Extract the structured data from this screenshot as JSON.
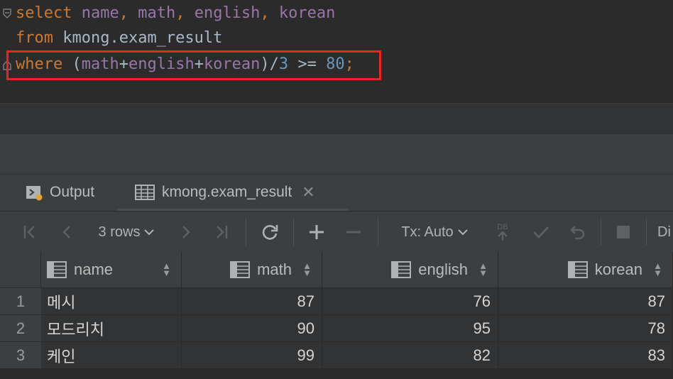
{
  "editor": {
    "line1": {
      "kw": "select",
      "cols": [
        "name",
        "math",
        "english",
        "korean"
      ]
    },
    "line2": {
      "kw": "from",
      "table": "kmong.exam_result"
    },
    "line3": {
      "kw": "where",
      "open": "(",
      "c1": "math",
      "plus1": "+",
      "c2": "english",
      "plus2": "+",
      "c3": "korean",
      "close": ")/",
      "n1": "3",
      "op": " >= ",
      "n2": "80",
      "end": ";"
    }
  },
  "tabs": [
    {
      "label": "Output",
      "icon": "console-icon"
    },
    {
      "label": "kmong.exam_result",
      "icon": "table-icon",
      "close": "✕"
    }
  ],
  "toolbar": {
    "rows_label": "3 rows",
    "tx_label": "Tx: Auto",
    "db_label": "DB",
    "trunc_label": "Di"
  },
  "grid": {
    "columns": [
      "name",
      "math",
      "english",
      "korean"
    ],
    "rows": [
      {
        "n": "1",
        "name": "메시",
        "math": "87",
        "english": "76",
        "korean": "87"
      },
      {
        "n": "2",
        "name": "모드리치",
        "math": "90",
        "english": "95",
        "korean": "78"
      },
      {
        "n": "3",
        "name": "케인",
        "math": "99",
        "english": "82",
        "korean": "83"
      }
    ]
  },
  "colors": {
    "keyword": "#cc7832",
    "column": "#9876aa",
    "number": "#6897bb",
    "highlight": "#e8261f"
  }
}
